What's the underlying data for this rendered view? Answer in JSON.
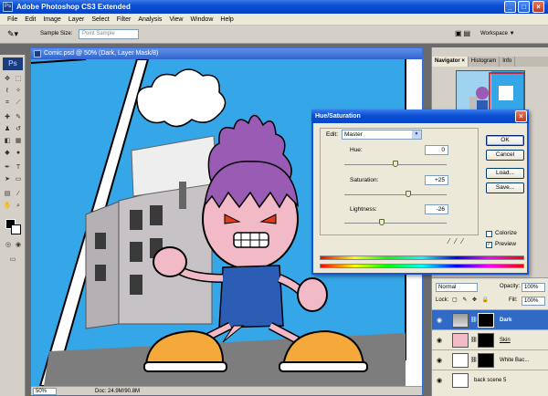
{
  "app": {
    "title": "Adobe Photoshop CS3 Extended",
    "window_controls": {
      "minimize": "_",
      "maximize": "□",
      "close": "×"
    }
  },
  "menu": [
    "File",
    "Edit",
    "Image",
    "Layer",
    "Select",
    "Filter",
    "Analysis",
    "View",
    "Window",
    "Help"
  ],
  "options_bar": {
    "sample_size_label": "Sample Size:",
    "sample_size_value": "Point Sample",
    "workspace_label": "Workspace ▼"
  },
  "toolbox": {
    "logo": "Ps"
  },
  "document": {
    "title": "Comic.psd @ 50% (Dark, Layer Mask/8)",
    "zoom": "50%",
    "doc_info": "Doc: 24.9M/90.8M"
  },
  "right_panel": {
    "tabs": [
      "Navigator ×",
      "Histogram",
      "Info"
    ],
    "layers": {
      "blend_mode": "Normal",
      "opacity_label": "Opacity:",
      "opacity_value": "100%",
      "lock_label": "Lock:",
      "fill_label": "Fill:",
      "fill_value": "100%",
      "rows": [
        {
          "name": "Dark",
          "selected": true
        },
        {
          "name": "Skin",
          "selected": false
        },
        {
          "name": "White Bac...",
          "selected": false
        },
        {
          "name": "back scene 5",
          "selected": false
        }
      ]
    }
  },
  "dialog": {
    "title": "Hue/Saturation",
    "edit_label": "Edit:",
    "edit_value": "Master",
    "hue_label": "Hue:",
    "hue_value": "0",
    "saturation_label": "Saturation:",
    "saturation_value": "+25",
    "lightness_label": "Lightness:",
    "lightness_value": "-26",
    "hue_level": 0.5,
    "saturation_level": 0.625,
    "lightness_level": 0.37,
    "buttons": {
      "ok": "OK",
      "cancel": "Cancel",
      "load": "Load...",
      "save": "Save..."
    },
    "colorize_label": "Colorize",
    "colorize_checked": false,
    "preview_label": "Preview",
    "preview_checked": true
  },
  "colors": {
    "xp_blue": "#0a4fd4",
    "sky": "#35a6e8",
    "hair": "#9a5bb5",
    "shirt": "#2c5db5",
    "shoe": "#f5a93a",
    "building": "#bdbdbd"
  }
}
